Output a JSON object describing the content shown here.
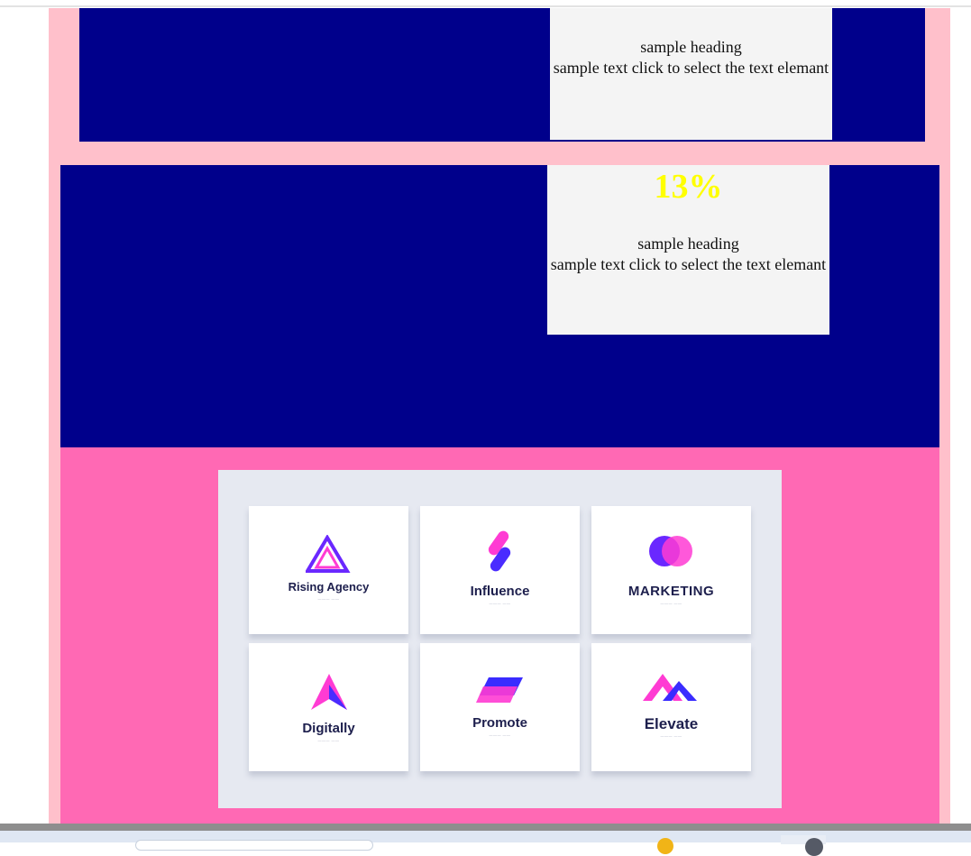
{
  "section1": {
    "heading": "sample heading",
    "text": "sample text click to select the text elemant"
  },
  "section2": {
    "percent": "13%",
    "heading": "sample heading",
    "text": "sample text click to select the text elemant"
  },
  "logos": [
    {
      "name": "Rising Agency",
      "icon": "triangle-logo-icon"
    },
    {
      "name": "Influence",
      "icon": "pill-logo-icon"
    },
    {
      "name": "MARKETING",
      "icon": "circles-logo-icon"
    },
    {
      "name": "Digitally",
      "icon": "arrow-logo-icon"
    },
    {
      "name": "Promote",
      "icon": "parallelogram-logo-icon"
    },
    {
      "name": "Elevate",
      "icon": "chevron-logo-icon"
    }
  ],
  "colors": {
    "page_bg": "#ffc0cb",
    "banner": "#00008b",
    "card": "#f4f4f4",
    "percent": "#ffff00",
    "accent_band": "#ff69b4"
  }
}
